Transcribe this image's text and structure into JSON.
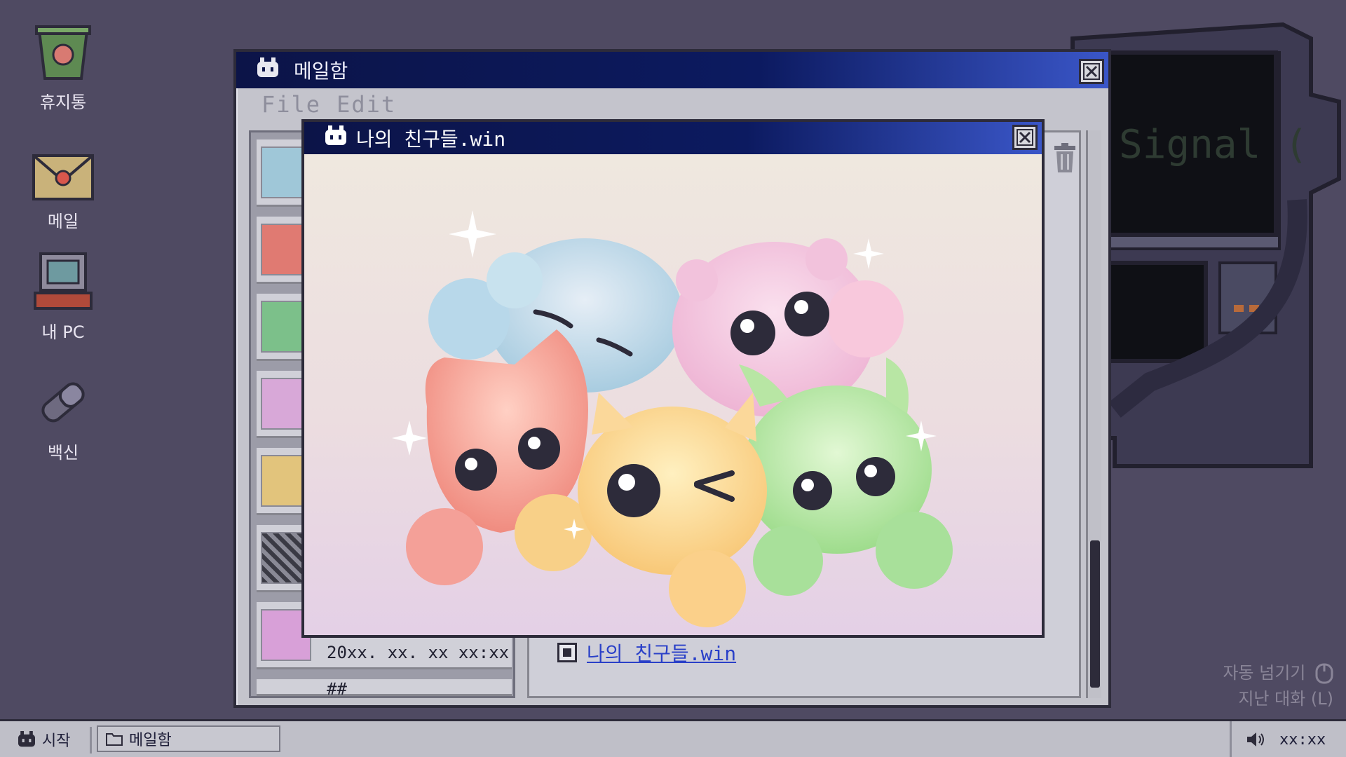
{
  "desktop": {
    "icons": [
      {
        "label": "휴지통",
        "icon": "trash-bin-icon"
      },
      {
        "label": "메일",
        "icon": "mail-envelope-icon"
      },
      {
        "label": "내 PC",
        "icon": "computer-icon"
      },
      {
        "label": "백신",
        "icon": "vaccine-icon"
      }
    ]
  },
  "machine": {
    "screen_text": "Signal ("
  },
  "mailbox": {
    "title": "메일함",
    "menu": [
      "File",
      "Edit"
    ],
    "list_items": [
      {
        "line1": "20xx. xx. xx xx:xx"
      },
      {
        "line1": "##"
      }
    ],
    "attachment": "나의 친구들.win"
  },
  "friends_window": {
    "title": "나의 친구들.win"
  },
  "hints": {
    "auto_skip": "자동 넘기기",
    "past_dialogue": "지난 대화 (L)"
  },
  "taskbar": {
    "start": "시작",
    "task": "메일함",
    "clock": "xx:xx"
  },
  "colors": {
    "desktop": "#4f4a62",
    "title_bar": "#0c1448",
    "window": "#c4c4cc",
    "link": "#2a40c8"
  }
}
